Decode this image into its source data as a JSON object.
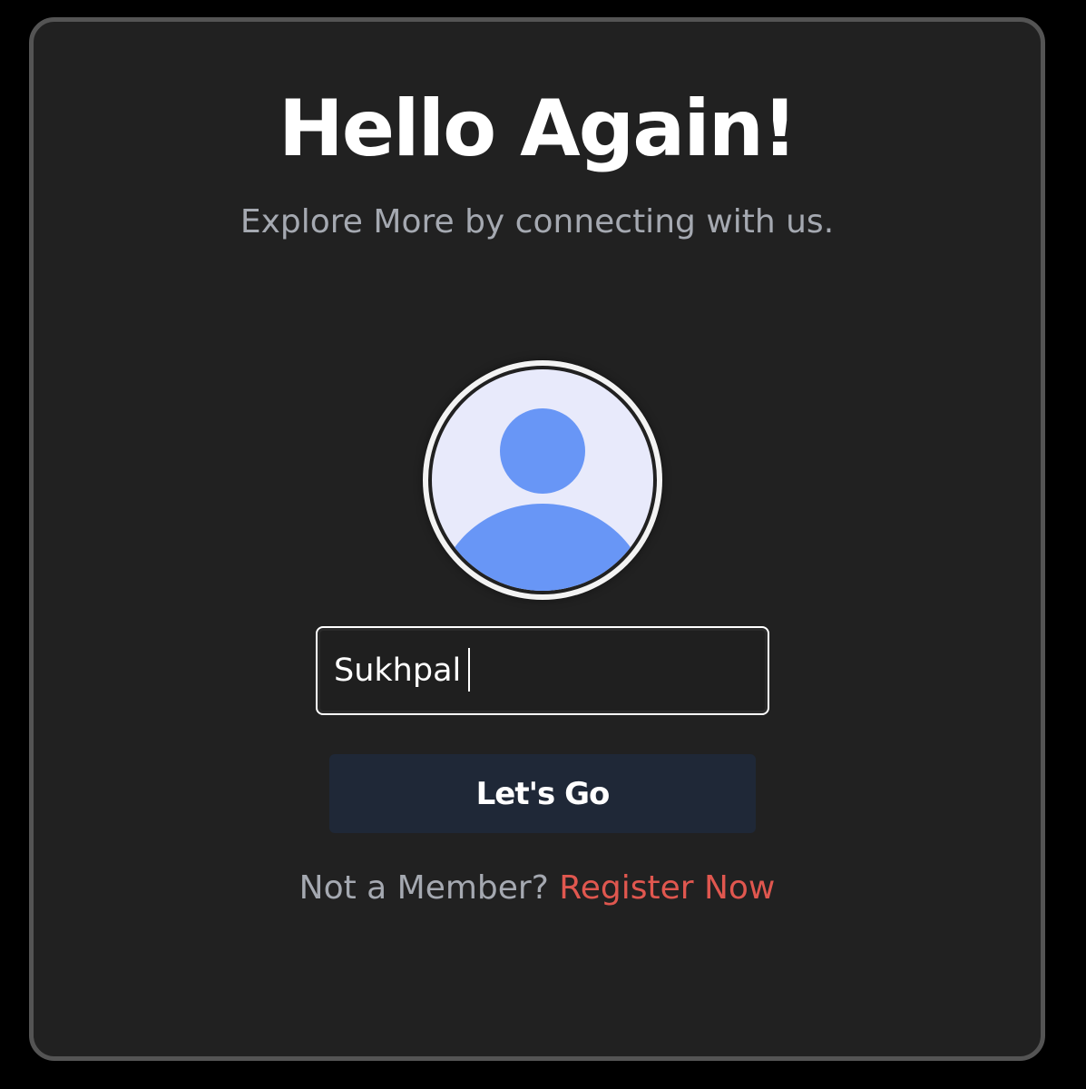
{
  "heading": "Hello Again!",
  "subheading": "Explore More by connecting with us.",
  "avatar": {
    "icon": "user-profile-icon",
    "background_color": "#e8eafb",
    "figure_color": "#6896f6"
  },
  "username_field": {
    "value": "Sukhpal"
  },
  "submit_button": {
    "label": "Let's Go"
  },
  "register": {
    "prompt": "Not a Member?",
    "link_label": "Register Now",
    "link_color": "#e0574f"
  }
}
